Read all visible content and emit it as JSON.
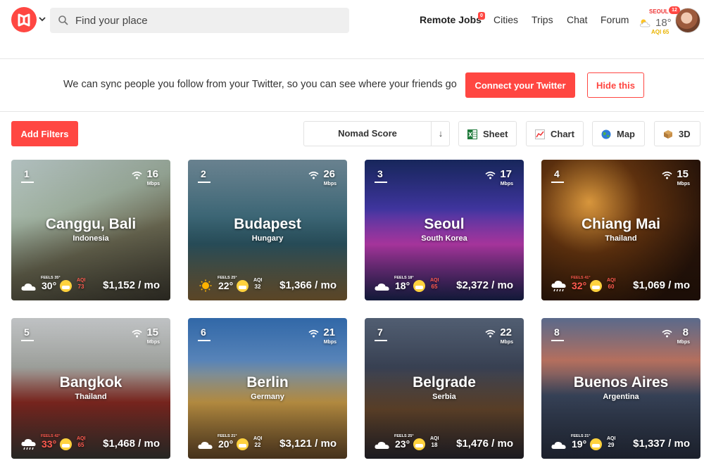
{
  "header": {
    "search_placeholder": "Find your place",
    "nav": {
      "remote_jobs": "Remote Jobs",
      "remote_jobs_badge": "0",
      "cities": "Cities",
      "trips": "Trips",
      "chat": "Chat",
      "forum": "Forum"
    },
    "weather": {
      "city": "SEOUL",
      "temp": "18°",
      "aqi": "AQI 65",
      "icon": "partly-cloudy-icon"
    },
    "user": {
      "notification_count": "12"
    }
  },
  "banner": {
    "text": "We can sync people you follow from your Twitter, so you can see where your friends go",
    "connect_label": "Connect your Twitter",
    "hide_label": "Hide this"
  },
  "toolbar": {
    "filters_label": "Add Filters",
    "sort_label": "Nomad Score",
    "sort_arrow": "↓",
    "views": {
      "sheet": "Sheet",
      "chart": "Chart",
      "map": "Map",
      "3d": "3D"
    }
  },
  "colors": {
    "accent": "#ff4742",
    "aqi_yellow": "#e9b400"
  },
  "cities": [
    {
      "rank": "1",
      "name": "Canggu, Bali",
      "country": "Indonesia",
      "speed": "16",
      "speed_unit": "Mbps",
      "feels": "FEELS 35°",
      "temp": "30°",
      "temp_hot": false,
      "aqi_label": "AQI",
      "aqi": "73",
      "aqi_hot": true,
      "cost": "$1,152 / mo",
      "weather_icon": "cloud-icon"
    },
    {
      "rank": "2",
      "name": "Budapest",
      "country": "Hungary",
      "speed": "26",
      "speed_unit": "Mbps",
      "feels": "FEELS 25°",
      "temp": "22°",
      "temp_hot": false,
      "aqi_label": "AQI",
      "aqi": "32",
      "aqi_hot": false,
      "cost": "$1,366 / mo",
      "weather_icon": "sun-icon"
    },
    {
      "rank": "3",
      "name": "Seoul",
      "country": "South Korea",
      "speed": "17",
      "speed_unit": "Mbps",
      "feels": "FEELS 18°",
      "temp": "18°",
      "temp_hot": false,
      "aqi_label": "AQI",
      "aqi": "65",
      "aqi_hot": true,
      "cost": "$2,372 / mo",
      "weather_icon": "cloud-icon"
    },
    {
      "rank": "4",
      "name": "Chiang Mai",
      "country": "Thailand",
      "speed": "15",
      "speed_unit": "Mbps",
      "feels": "FEELS 41°",
      "temp": "32°",
      "temp_hot": true,
      "aqi_label": "AQI",
      "aqi": "60",
      "aqi_hot": true,
      "cost": "$1,069 / mo",
      "weather_icon": "rain-cloud-icon"
    },
    {
      "rank": "5",
      "name": "Bangkok",
      "country": "Thailand",
      "speed": "15",
      "speed_unit": "Mbps",
      "feels": "FEELS 42°",
      "temp": "33°",
      "temp_hot": true,
      "aqi_label": "AQI",
      "aqi": "65",
      "aqi_hot": true,
      "cost": "$1,468 / mo",
      "weather_icon": "rain-cloud-icon"
    },
    {
      "rank": "6",
      "name": "Berlin",
      "country": "Germany",
      "speed": "21",
      "speed_unit": "Mbps",
      "feels": "FEELS 21°",
      "temp": "20°",
      "temp_hot": false,
      "aqi_label": "AQI",
      "aqi": "22",
      "aqi_hot": false,
      "cost": "$3,121 / mo",
      "weather_icon": "cloud-icon"
    },
    {
      "rank": "7",
      "name": "Belgrade",
      "country": "Serbia",
      "speed": "22",
      "speed_unit": "Mbps",
      "feels": "FEELS 25°",
      "temp": "23°",
      "temp_hot": false,
      "aqi_label": "AQI",
      "aqi": "18",
      "aqi_hot": false,
      "cost": "$1,476 / mo",
      "weather_icon": "cloud-icon"
    },
    {
      "rank": "8",
      "name": "Buenos Aires",
      "country": "Argentina",
      "speed": "8",
      "speed_unit": "Mbps",
      "feels": "FEELS 21°",
      "temp": "19°",
      "temp_hot": false,
      "aqi_label": "AQI",
      "aqi": "29",
      "aqi_hot": false,
      "cost": "$1,337 / mo",
      "weather_icon": "cloud-icon"
    }
  ]
}
